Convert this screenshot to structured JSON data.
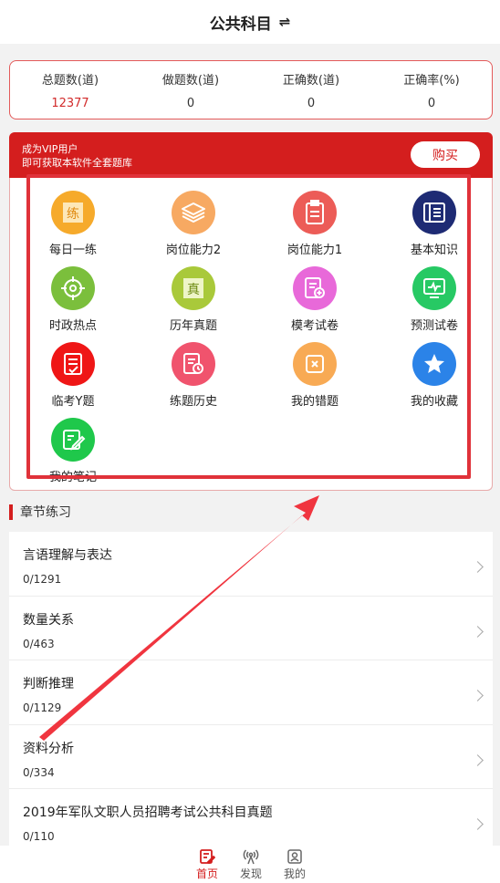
{
  "header": {
    "title": "公共科目",
    "swap_icon": "⇌"
  },
  "stats": [
    {
      "label": "总题数(道)",
      "value": "12377",
      "highlight": true
    },
    {
      "label": "做题数(道)",
      "value": "0"
    },
    {
      "label": "正确数(道)",
      "value": "0"
    },
    {
      "label": "正确率(%)",
      "value": "0"
    }
  ],
  "vip": {
    "line1": "成为VIP用户",
    "line2": "即可获取本软件全套题库",
    "buy_label": "购买"
  },
  "grid": [
    {
      "label": "每日一练",
      "icon": "daily-practice-icon",
      "color": "#f6aa2b",
      "glyph": "练"
    },
    {
      "label": "岗位能力2",
      "icon": "layers-icon",
      "color": "#f7a962"
    },
    {
      "label": "岗位能力1",
      "icon": "clipboard-icon",
      "color": "#ec5c57"
    },
    {
      "label": "基本知识",
      "icon": "book-icon",
      "color": "#1e2b74"
    },
    {
      "label": "时政热点",
      "icon": "target-icon",
      "color": "#7bbf3c"
    },
    {
      "label": "历年真题",
      "icon": "past-exam-icon",
      "color": "#a9c93a",
      "glyph": "真"
    },
    {
      "label": "模考试卷",
      "icon": "mock-exam-icon",
      "color": "#e869d9"
    },
    {
      "label": "预测试卷",
      "icon": "monitor-icon",
      "color": "#27c964"
    },
    {
      "label": "临考Y题",
      "icon": "checklist-icon",
      "color": "#ef1616"
    },
    {
      "label": "练题历史",
      "icon": "history-icon",
      "color": "#f0536d"
    },
    {
      "label": "我的错题",
      "icon": "wrong-questions-icon",
      "color": "#f8aa54"
    },
    {
      "label": "我的收藏",
      "icon": "star-icon",
      "color": "#2b83e8"
    },
    {
      "label": "我的笔记",
      "icon": "notes-icon",
      "color": "#1fc84b"
    }
  ],
  "section": {
    "title": "章节练习"
  },
  "chapters": [
    {
      "name": "言语理解与表达",
      "count": "0/1291"
    },
    {
      "name": "数量关系",
      "count": "0/463"
    },
    {
      "name": "判断推理",
      "count": "0/1129"
    },
    {
      "name": "资料分析",
      "count": "0/334"
    },
    {
      "name": "2019年军队文职人员招聘考试公共科目真题",
      "count": "0/110"
    }
  ],
  "tabs": [
    {
      "label": "首页",
      "icon": "home-icon",
      "active": true
    },
    {
      "label": "发现",
      "icon": "broadcast-icon"
    },
    {
      "label": "我的",
      "icon": "profile-icon"
    }
  ],
  "colors": {
    "accent": "#d41e1e",
    "annotation": "#e0323a"
  }
}
